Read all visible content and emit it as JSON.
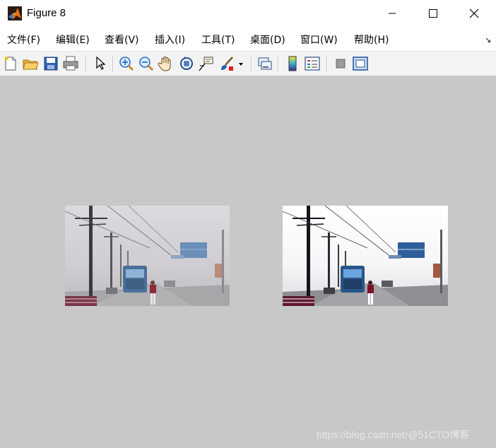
{
  "window": {
    "title": "Figure 8",
    "controls": [
      "minimize",
      "maximize",
      "close"
    ]
  },
  "menu": {
    "items": [
      {
        "label": "文件(F)"
      },
      {
        "label": "编辑(E)"
      },
      {
        "label": "查看(V)"
      },
      {
        "label": "插入(I)"
      },
      {
        "label": "工具(T)"
      },
      {
        "label": "桌面(D)"
      },
      {
        "label": "窗口(W)"
      },
      {
        "label": "帮助(H)"
      }
    ],
    "dock_glyph": "↘"
  },
  "toolbar": {
    "icons": [
      "new-figure-icon",
      "open-file-icon",
      "save-icon",
      "print-icon",
      "pointer-icon",
      "zoom-in-icon",
      "zoom-out-icon",
      "pan-hand-icon",
      "rotate-3d-icon",
      "data-cursor-icon",
      "brush-icon",
      "brush-dropdown-icon",
      "link-plot-icon",
      "colorbar-icon",
      "legend-icon",
      "hide-plot-tools-icon",
      "show-plot-tools-icon"
    ]
  },
  "figure": {
    "background": "#c8c8c8",
    "panels": [
      {
        "name": "original-hazy-image",
        "content": "foggy street scene with tram, poles and pedestrian"
      },
      {
        "name": "dehazed-image",
        "content": "enhanced street scene with tram, poles and pedestrian"
      }
    ]
  },
  "watermark": "https://blog.csdn.net/@51CTO博客"
}
